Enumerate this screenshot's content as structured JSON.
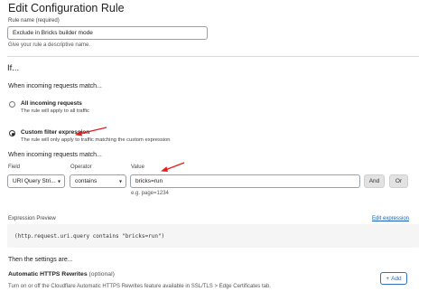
{
  "page": {
    "title": "Edit Configuration Rule"
  },
  "rule_name": {
    "label": "Rule name (required)",
    "value": "Exclude in Bricks builder mode",
    "helper": "Give your rule a descriptive name."
  },
  "if_section": {
    "heading": "If...",
    "match_heading": "When incoming requests match...",
    "options": [
      {
        "title": "All incoming requests",
        "desc": "The rule will apply to all traffic",
        "selected": false
      },
      {
        "title": "Custom filter expression",
        "desc": "The rule will only apply to traffic matching the custom expression",
        "selected": true
      }
    ]
  },
  "filter": {
    "heading": "When incoming requests match...",
    "field_label": "Field",
    "operator_label": "Operator",
    "value_label": "Value",
    "field_value": "URI Query Stri...",
    "operator_value": "contains",
    "value_value": "bricks=run",
    "value_hint": "e.g. page=1234",
    "and_label": "And",
    "or_label": "Or"
  },
  "expression": {
    "label": "Expression Preview",
    "edit_link": "Edit expression",
    "code": "(http.request.uri.query contains \"bricks=run\")"
  },
  "then_section": {
    "heading": "Then the settings are...",
    "setting_title": "Automatic HTTPS Rewrites",
    "setting_optional": "(optional)",
    "setting_desc": "Turn on or off the Cloudflare Automatic HTTPS Rewrites feature available in SSL/TLS > Edge Certificates tab.",
    "add_label": "Add"
  },
  "colors": {
    "annotation_arrow": "#e02020",
    "link": "#1a5fb4"
  }
}
